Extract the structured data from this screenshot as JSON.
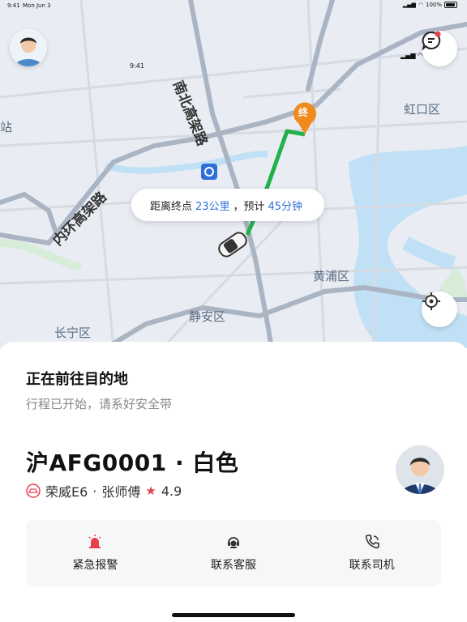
{
  "status_bar": {
    "time": "9:41",
    "date": "Mon Jun 3",
    "battery": "100%"
  },
  "map": {
    "mini_status_time": "9:41",
    "districts": [
      "虹口区",
      "黄浦区",
      "静安区",
      "长宁区",
      "站"
    ],
    "roads": [
      "南北高架路",
      "内环高架路"
    ],
    "destination_marker": "终",
    "info": {
      "prefix": "距离终点",
      "distance": "23公里",
      "middle": "，预计",
      "eta": "45分钟"
    }
  },
  "trip": {
    "title": "正在前往目的地",
    "subtitle": "行程已开始，请系好安全带",
    "plate": "沪AFG0001 · 白色",
    "car_model": "荣威E6",
    "separator": "·",
    "driver": "张师傅",
    "rating": "4.9"
  },
  "actions": [
    {
      "label": "紧急报警",
      "icon": "alarm-icon"
    },
    {
      "label": "联系客服",
      "icon": "customer-service-icon"
    },
    {
      "label": "联系司机",
      "icon": "phone-icon"
    }
  ],
  "colors": {
    "accent": "#2f6fd9",
    "route": "#22b14c",
    "marker": "#f08a1c",
    "alarm": "#e6404e"
  }
}
